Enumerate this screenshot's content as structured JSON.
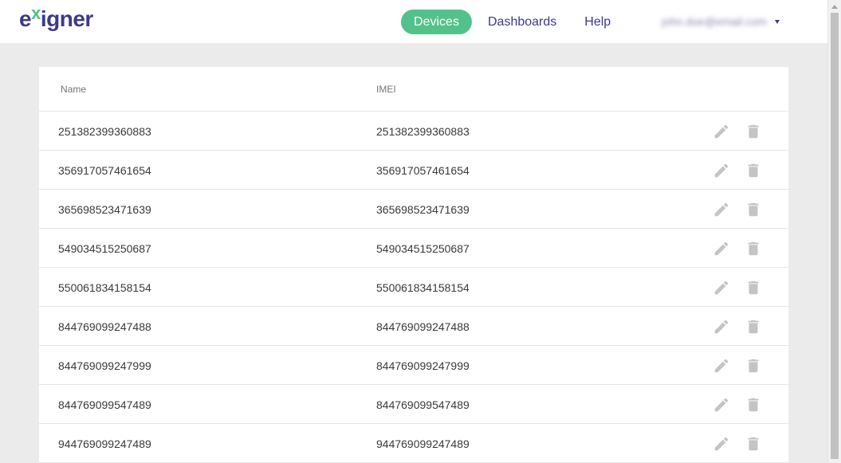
{
  "header": {
    "logo": {
      "prefix": "e",
      "x": "x",
      "suffix": "igner"
    },
    "nav": {
      "devices": "Devices",
      "dashboards": "Dashboards",
      "help": "Help"
    },
    "user_email": "john.doe@email.com"
  },
  "table": {
    "columns": {
      "name": "Name",
      "imei": "IMEI"
    },
    "rows": [
      {
        "name": "251382399360883",
        "imei": "251382399360883"
      },
      {
        "name": "356917057461654",
        "imei": "356917057461654"
      },
      {
        "name": "365698523471639",
        "imei": "365698523471639"
      },
      {
        "name": "549034515250687",
        "imei": "549034515250687"
      },
      {
        "name": "550061834158154",
        "imei": "550061834158154"
      },
      {
        "name": "844769099247488",
        "imei": "844769099247488"
      },
      {
        "name": "844769099247999",
        "imei": "844769099247999"
      },
      {
        "name": "844769099547489",
        "imei": "844769099547489"
      },
      {
        "name": "944769099247489",
        "imei": "944769099247489"
      }
    ]
  },
  "icons": {
    "edit": "pencil-icon",
    "delete": "trash-icon",
    "menu": "caret-down-icon"
  },
  "colors": {
    "brand": "#3d3a8c",
    "accent": "#52c28a",
    "icon_gray": "#c4c4c4",
    "page_bg": "#ebebeb"
  }
}
